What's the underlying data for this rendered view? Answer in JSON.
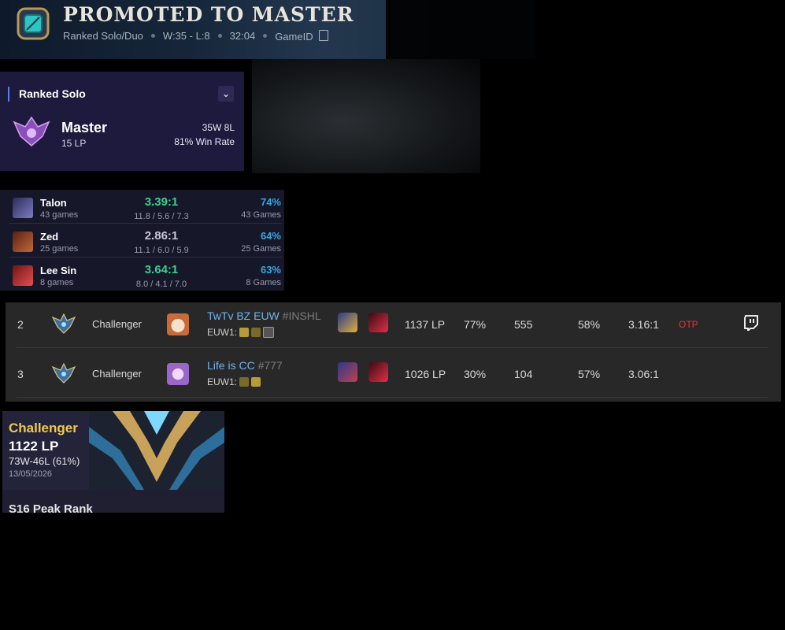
{
  "banner": {
    "title": "PROMOTED TO MASTER",
    "queue": "Ranked Solo/Duo",
    "record": "W:35 - L:8",
    "duration": "32:04",
    "game_id_label": "GameID"
  },
  "ranked_card": {
    "queue": "Ranked Solo",
    "tier": "Master",
    "lp": "15 LP",
    "wins_losses": "35W 8L",
    "win_rate": "81% Win Rate"
  },
  "champions": [
    {
      "name": "Talon",
      "games": "43 games",
      "kda": "3.39:1",
      "kda_good": true,
      "avg": "11.8 / 5.6 / 7.3",
      "win_rate": "74%",
      "games_total": "43 Games",
      "color": "#4b4f8c"
    },
    {
      "name": "Zed",
      "games": "25 games",
      "kda": "2.86:1",
      "kda_good": false,
      "avg": "11.1 / 6.0 / 5.9",
      "win_rate": "64%",
      "games_total": "25 Games",
      "color": "#8a3a24"
    },
    {
      "name": "Lee Sin",
      "games": "8 games",
      "kda": "3.64:1",
      "kda_good": true,
      "avg": "8.0 / 4.1 / 7.0",
      "win_rate": "63%",
      "games_total": "8 Games",
      "color": "#a8272d"
    }
  ],
  "leaderboard": [
    {
      "rank": "2",
      "tier": "Challenger",
      "name": "TwTv BZ EUW",
      "tag": "#INSHL",
      "server": "EUW1:",
      "lp": "1137 LP",
      "winrate": "77%",
      "games": "555",
      "champ_wr": "58%",
      "kda": "3.16:1",
      "badge": "OTP",
      "avatar_color": "#c86a3a"
    },
    {
      "rank": "3",
      "tier": "Challenger",
      "name": "Life is CC",
      "tag": "#777",
      "server": "EUW1:",
      "lp": "1026 LP",
      "winrate": "30%",
      "games": "104",
      "champ_wr": "57%",
      "kda": "3.06:1",
      "badge": "",
      "avatar_color": "#9a66c8"
    }
  ],
  "challenger_card": {
    "tier": "Challenger",
    "lp": "1122 LP",
    "record": "73W-46L (61%)",
    "date": "13/05/2026",
    "peak_label": "S16 Peak Rank"
  }
}
